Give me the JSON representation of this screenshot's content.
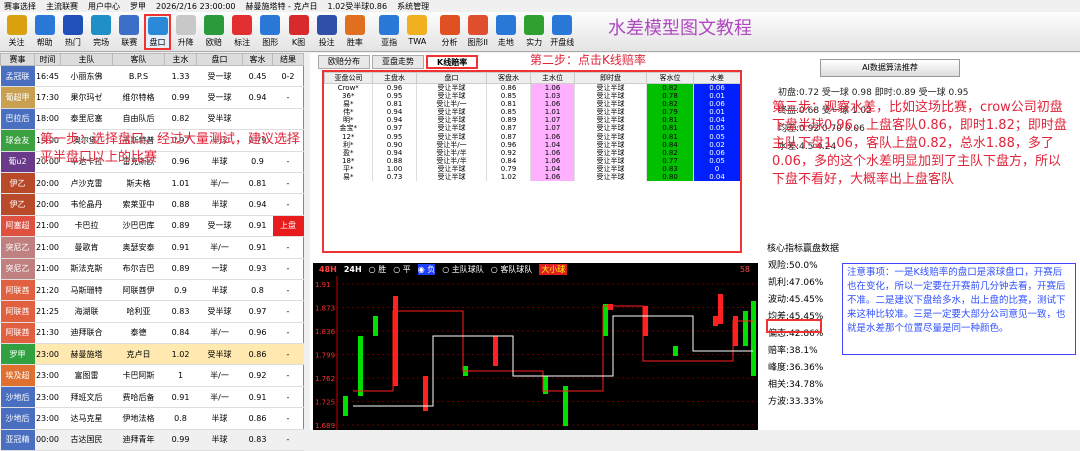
{
  "menubar": {
    "items": [
      "赛事选择",
      "主流联赛",
      "用户中心",
      "罗甲",
      "2026/2/16 23:00:00",
      "赫曼施塔特 - 克卢日",
      "1.02受半球0.86",
      "系统管理"
    ]
  },
  "toolbar": {
    "buttons": [
      {
        "label": "关注",
        "icon": "trophy-icon",
        "color": "#d9a010"
      },
      {
        "label": "帮助",
        "icon": "help-icon",
        "color": "#2a78d8"
      },
      {
        "label": "热门",
        "icon": "hot-icon",
        "color": "#2050b8"
      },
      {
        "label": "完场",
        "icon": "globe-icon",
        "color": "#1f8fc8"
      },
      {
        "label": "联赛",
        "icon": "search-icon",
        "color": "#3c6fc8"
      },
      {
        "label": "盘口",
        "icon": "search-plus-icon",
        "color": "#2a8ad8",
        "selected": true
      },
      {
        "label": "升降",
        "icon": "updown-icon",
        "color": "#c8c8c8"
      },
      {
        "label": "欧赔",
        "icon": "excel-icon",
        "color": "#2a9a3a"
      },
      {
        "label": "标注",
        "icon": "heart-icon",
        "color": "#e23030"
      },
      {
        "label": "图形",
        "icon": "image-icon",
        "color": "#2a78d8"
      },
      {
        "label": "K图",
        "icon": "k-chart-icon",
        "color": "#d82a2a"
      },
      {
        "label": "投注",
        "icon": "edit-icon",
        "color": "#3050a8"
      },
      {
        "label": "胜率",
        "icon": "chart-icon",
        "color": "#e07020"
      },
      {
        "label": "亚指",
        "icon": "pie-icon",
        "color": "#2a78d8"
      },
      {
        "label": "TWA",
        "icon": "twa-icon",
        "color": "#f0b020"
      },
      {
        "label": "分析",
        "icon": "analysis-icon",
        "color": "#e05020"
      },
      {
        "label": "图形II",
        "icon": "photo-icon",
        "color": "#e05030"
      },
      {
        "label": "走地",
        "icon": "tools-icon",
        "color": "#2a78d8"
      },
      {
        "label": "实力",
        "icon": "power-icon",
        "color": "#30a030"
      },
      {
        "label": "开盘线",
        "icon": "s-icon",
        "color": "#2a78d8"
      }
    ]
  },
  "tutorial_title": "水差模型图文教程",
  "match_table": {
    "headers": [
      "赛事",
      "时间",
      "主队",
      "客队",
      "主水",
      "盘口",
      "客水",
      "结果"
    ],
    "rows": [
      {
        "league": "孟冠联",
        "color": "#4a6fc0",
        "time": "16:45",
        "home": "小丽东佛",
        "away": "B.P.S",
        "hw": "1.33",
        "line": "受一球",
        "aw": "0.45",
        "res": "0-2"
      },
      {
        "league": "葡超甲",
        "color": "#c8a050",
        "time": "17:30",
        "home": "果尔玛ゼ",
        "away": "维尔特格",
        "hw": "0.99",
        "line": "受一球",
        "aw": "0.94",
        "res": "-"
      },
      {
        "league": "巴拉后",
        "color": "#4a6fc0",
        "time": "18:00",
        "home": "泰里尼塞",
        "away": "自由队后",
        "hw": "0.82",
        "line": "受半球",
        "aw": "",
        "res": ""
      },
      {
        "league": "球会友",
        "color": "#3aa040",
        "time": "19:00",
        "home": "奥尔堡(",
        "away": "韦斯特普",
        "hw": "0.97",
        "line": "半球",
        "aw": "0.79",
        "res": "-"
      },
      {
        "league": "葡u2",
        "color": "#6a3a8a",
        "time": "20:00",
        "home": "辛达卡拉",
        "away": "雷克斯欧",
        "hw": "0.96",
        "line": "半球",
        "aw": "0.9",
        "res": "-"
      },
      {
        "league": "伊乙",
        "color": "#b84a2a",
        "time": "20:00",
        "home": "卢沙克雷",
        "away": "斯夫格",
        "hw": "1.01",
        "line": "半/一",
        "aw": "0.81",
        "res": "-"
      },
      {
        "league": "伊乙",
        "color": "#b84a2a",
        "time": "20:00",
        "home": "韦伦晶丹",
        "away": "索莱亚中",
        "hw": "0.88",
        "line": "半球",
        "aw": "0.94",
        "res": "-"
      },
      {
        "league": "阿塞超",
        "color": "#e05040",
        "time": "21:00",
        "home": "卡巴拉",
        "away": "沙巴巴库",
        "hw": "0.89",
        "line": "受一球",
        "aw": "0.91",
        "res": "上盘"
      },
      {
        "league": "突尼乙",
        "color": "#c08080",
        "time": "21:00",
        "home": "曼歌肯",
        "away": "奥瑟安泰",
        "hw": "0.91",
        "line": "半/一",
        "aw": "0.91",
        "res": "-"
      },
      {
        "league": "突尼乙",
        "color": "#c08080",
        "time": "21:00",
        "home": "斯法克斯",
        "away": "布尔吉巴",
        "hw": "0.89",
        "line": "一球",
        "aw": "0.93",
        "res": "-"
      },
      {
        "league": "阿联酋",
        "color": "#e06040",
        "time": "21:20",
        "home": "马斯珊特",
        "away": "阿联酋伊",
        "hw": "0.9",
        "line": "半球",
        "aw": "0.8",
        "res": "-"
      },
      {
        "league": "阿联酋",
        "color": "#e06040",
        "time": "21:25",
        "home": "海湖联",
        "away": "哈利亚",
        "hw": "0.83",
        "line": "受半球",
        "aw": "0.97",
        "res": "-"
      },
      {
        "league": "阿联酋",
        "color": "#e06040",
        "time": "21:30",
        "home": "迪拜联合",
        "away": "泰德",
        "hw": "0.84",
        "line": "半/一",
        "aw": "0.96",
        "res": "-"
      },
      {
        "league": "罗甲",
        "color": "#30a040",
        "time": "23:00",
        "home": "赫曼施塔",
        "away": "克卢日",
        "hw": "1.02",
        "line": "受半球",
        "aw": "0.86",
        "res": "-",
        "sel": true
      },
      {
        "league": "埃及超",
        "color": "#e07030",
        "time": "23:00",
        "home": "富图雷",
        "away": "卡巴阿斯",
        "hw": "1",
        "line": "半/一",
        "aw": "0.92",
        "res": "-"
      },
      {
        "league": "沙地后",
        "color": "#4a6fc0",
        "time": "23:00",
        "home": "拜班文后",
        "away": "费哈后备",
        "hw": "0.91",
        "line": "半/一",
        "aw": "0.91",
        "res": "-"
      },
      {
        "league": "沙地后",
        "color": "#4a6fc0",
        "time": "23:00",
        "home": "达马克星",
        "away": "伊地法格",
        "hw": "0.8",
        "line": "半球",
        "aw": "0.86",
        "res": "-"
      },
      {
        "league": "亚冠精",
        "color": "#4a6fc0",
        "time": "00:00",
        "home": "古达国民",
        "away": "迪拜青年",
        "hw": "0.99",
        "line": "半球",
        "aw": "0.83",
        "res": "-"
      }
    ]
  },
  "step1_text": "第一步：选择盘口，经过大量测试，建议选择平半盘口以上的比赛",
  "tabs": [
    "欧赔分布",
    "亚盘走势",
    "K线赔率"
  ],
  "active_tab": "K线赔率",
  "step2_text": "第二步：点击K线赔率",
  "odds_table": {
    "headers": [
      "亚盘公司",
      "主盘水",
      "盘口",
      "客盘水",
      "主水位",
      "即时盘",
      "客水位",
      "水差"
    ],
    "rows": [
      [
        "Crow*",
        "0.96",
        "受让半球",
        "0.86",
        "1.06",
        "受让半球",
        "0.82",
        "0.06"
      ],
      [
        "36*",
        "0.95",
        "受让半球",
        "0.85",
        "1.03",
        "受让半球",
        "0.78",
        "0.01"
      ],
      [
        "易*",
        "0.81",
        "受让半/一",
        "0.81",
        "1.06",
        "受让半球",
        "0.82",
        "0.06"
      ],
      [
        "伟*",
        "0.94",
        "受让半球",
        "0.85",
        "1.01",
        "受让半球",
        "0.79",
        "0.01"
      ],
      [
        "明*",
        "0.94",
        "受让半球",
        "0.89",
        "1.07",
        "受让半球",
        "0.81",
        "0.04"
      ],
      [
        "金宝*",
        "0.97",
        "受让半球",
        "0.87",
        "1.07",
        "受让半球",
        "0.81",
        "0.05"
      ],
      [
        "12*",
        "0.95",
        "受让半球",
        "0.87",
        "1.06",
        "受让半球",
        "0.81",
        "0.05"
      ],
      [
        "利*",
        "0.90",
        "受让半/一",
        "0.96",
        "1.04",
        "受让半球",
        "0.84",
        "0.02"
      ],
      [
        "盈*",
        "0.94",
        "受让半/半",
        "0.92",
        "1.06",
        "受让半球",
        "0.82",
        "0.06"
      ],
      [
        "18*",
        "0.88",
        "受让半/半",
        "0.84",
        "1.06",
        "受让半球",
        "0.77",
        "0.05"
      ],
      [
        "平*",
        "1.00",
        "受让半球",
        "0.79",
        "1.04",
        "受让半球",
        "0.83",
        "0"
      ],
      [
        "易*",
        "0.73",
        "受让半球",
        "1.02",
        "1.06",
        "受让半球",
        "0.80",
        "0.04"
      ]
    ]
  },
  "chart": {
    "tabs": [
      "48H",
      "24H"
    ],
    "legend": [
      "胜",
      "平",
      "负",
      "主队球队",
      "客队球队",
      "大小球"
    ],
    "selected": "负",
    "yticks": [
      "1.91",
      "1.873",
      "1.836",
      "1.799",
      "1.762",
      "1.725",
      "1.689"
    ],
    "right_label": "58"
  },
  "right": {
    "ai_button": "AI数据算法推荐",
    "info": [
      "初盘:0.72 受一球 0.98 即时:0.89 受一球 0.95",
      "终盘:0.68 受一球 1.02",
      "均差:0.92 0.70 0.06",
      "水差:4.5 4.24"
    ],
    "step3_text": "第三步：观察水差，比如这场比赛，crow公司初盘下盘半球0.96、上盘客队0.86，即时1.82；即时盘主队下盘1.06，客队上盘0.82，总水1.88，多了0.06，多的这个水差明显加到了主队下盘方，所以下盘不看好，大概率出上盘客队",
    "stats_title": "核心指标赢盘数据",
    "stats": [
      "观险:50.0%",
      "凯利:47.06%",
      "波动:45.45%",
      "均差:45.45%",
      "偏态:42.86%",
      "赔率:38.1%",
      "峰度:36.36%",
      "相关:34.78%",
      "方波:33.33%"
    ],
    "note": "注意事项：一是K线赔率的盘口是滚球盘口，开赛后也在变化，所以一定要在开赛前几分钟去看，开赛后不准。二是建议下盘给多水，出上盘的比赛，测试下来这种比较准。三是一定要大部分公司意见一致，也就是水差那个位置尽量是同一种颜色。"
  }
}
